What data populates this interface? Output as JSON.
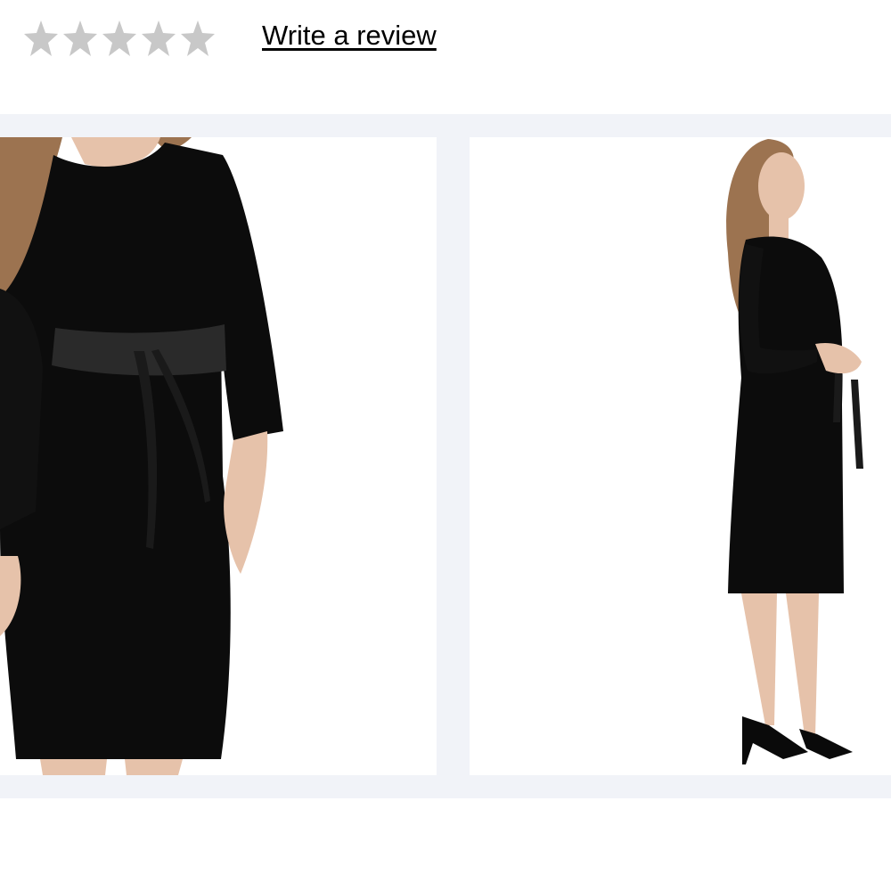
{
  "rating": {
    "stars_total": 5,
    "stars_filled": 0,
    "star_color": "#c8c8c8",
    "icon": "star-icon"
  },
  "review_link": {
    "label": "Write a review"
  },
  "gallery": {
    "background": "#f1f3f8",
    "images": [
      {
        "name": "front-closeup-photo"
      },
      {
        "name": "side-full-length-photo"
      }
    ]
  },
  "colors": {
    "dress": "#0c0c0c",
    "belt": "#2a2a2a",
    "skin": "#e6c2aa",
    "hair": "#9c7350"
  }
}
